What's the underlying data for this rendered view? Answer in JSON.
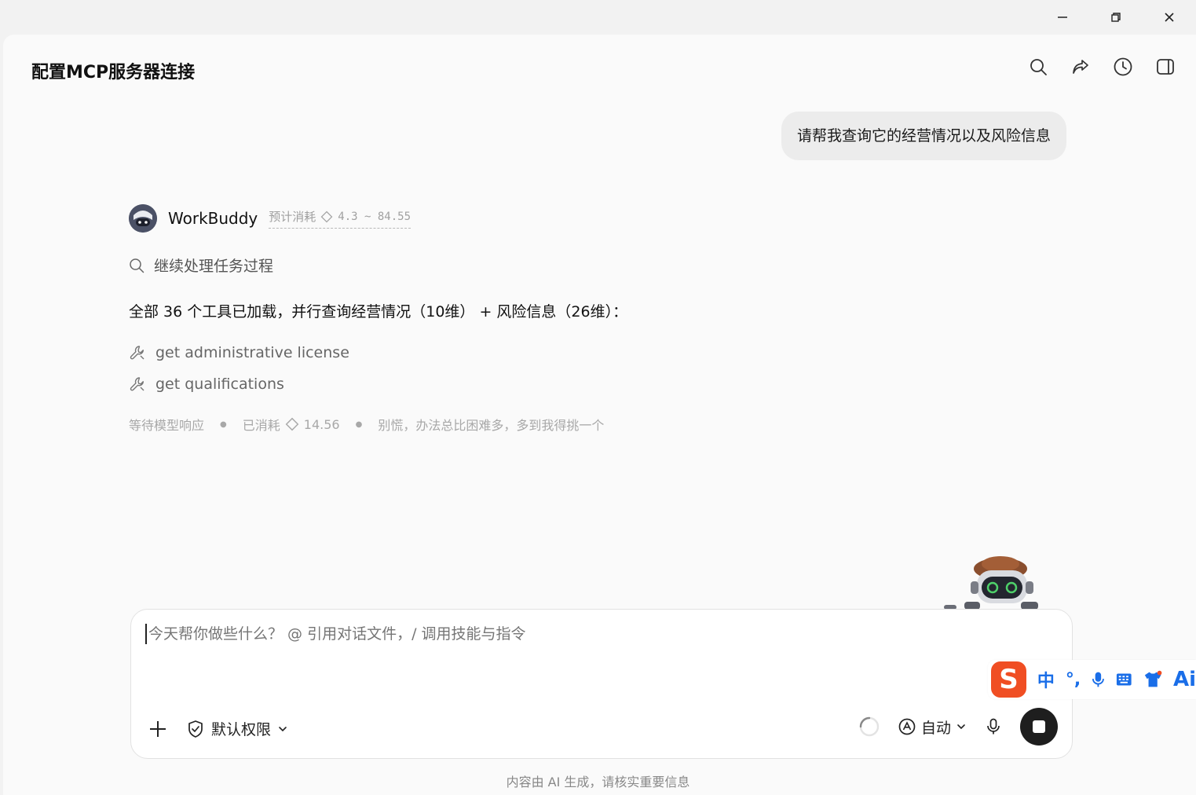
{
  "window": {
    "controls": [
      "minimize",
      "restore",
      "close"
    ]
  },
  "header": {
    "title": "配置MCP服务器连接",
    "tools": [
      "search-icon",
      "share-icon",
      "history-icon",
      "sidebar-toggle-icon"
    ]
  },
  "conversation": {
    "user_message": "请帮我查询它的经营情况以及风险信息",
    "agent": {
      "name": "WorkBuddy",
      "est_label": "预计消耗",
      "est_range": "4.3 ~ 84.55",
      "continue_text": "继续处理任务过程",
      "loaded_msg": "全部 36 个工具已加载，并行查询经营情况（10维） + 风险信息（26维）：",
      "tool_calls": [
        {
          "label": "get administrative license"
        },
        {
          "label": "get qualifications"
        }
      ],
      "status": {
        "waiting": "等待模型响应",
        "consumed_label": "已消耗",
        "consumed_value": "14.56",
        "tip": "别慌，办法总比困难多，多到我得挑一个"
      }
    }
  },
  "composer": {
    "placeholder": "今天帮你做些什么？ @ 引用对话文件，/ 调用技能与指令",
    "permission_label": "默认权限",
    "mode_label": "自动"
  },
  "footer": {
    "disclaimer": "内容由 AI 生成，请核实重要信息"
  },
  "ime": {
    "logo": "S",
    "lang": "中",
    "punct": "°,",
    "ai": "Ai"
  },
  "colors": {
    "accent_ime": "#1a6ee8",
    "ime_logo": "#f04e23",
    "stop_button": "#1e1e1e"
  }
}
